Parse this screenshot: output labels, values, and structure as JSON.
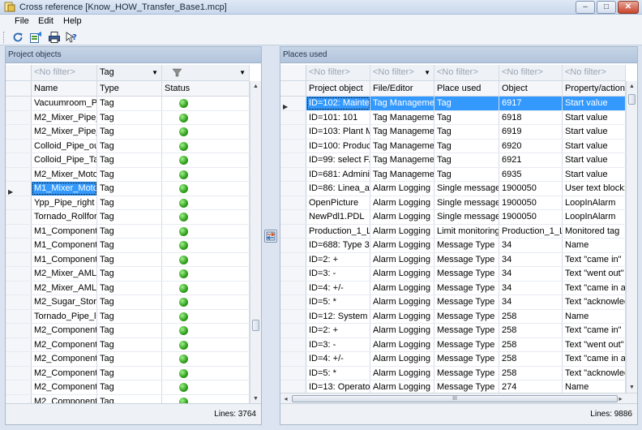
{
  "window": {
    "title": "Cross reference [Know_HOW_Transfer_Base1.mcp]",
    "icon": "cross-reference-app-icon"
  },
  "menu": [
    "File",
    "Edit",
    "Help"
  ],
  "toolbar": {
    "icons": [
      "refresh-icon",
      "export-icon",
      "print-icon",
      "help-icon"
    ]
  },
  "left_panel": {
    "title": "Project objects",
    "filters": [
      {
        "text": "<No filter>",
        "dropdown": false
      },
      {
        "text": "Tag",
        "dropdown": true
      },
      {
        "text": "",
        "dropdown": true,
        "icon": "filter-funnel-icon"
      }
    ],
    "columns": [
      "Name",
      "Type",
      "Status"
    ],
    "rows": [
      {
        "name": "Vacuumroom_Pi...",
        "type": "Tag"
      },
      {
        "name": "M2_Mixer_Pipe_...",
        "type": "Tag"
      },
      {
        "name": "M2_Mixer_Pipe_...",
        "type": "Tag"
      },
      {
        "name": "Colloid_Pipe_out...",
        "type": "Tag"
      },
      {
        "name": "Colloid_Pipe_Tank",
        "type": "Tag"
      },
      {
        "name": "M2_Mixer_Motor",
        "type": "Tag"
      },
      {
        "name": "M1_Mixer_Motor",
        "type": "Tag",
        "selected": true
      },
      {
        "name": "Ypp_Pipe_right",
        "type": "Tag"
      },
      {
        "name": "Tornado_Rollfor...",
        "type": "Tag"
      },
      {
        "name": "M1_Component...",
        "type": "Tag"
      },
      {
        "name": "M1_Component...",
        "type": "Tag"
      },
      {
        "name": "M1_Component...",
        "type": "Tag"
      },
      {
        "name": "M2_Mixer_AML_...",
        "type": "Tag"
      },
      {
        "name": "M2_Mixer_AML_...",
        "type": "Tag"
      },
      {
        "name": "M2_Sugar_Stora...",
        "type": "Tag"
      },
      {
        "name": "Tornado_Pipe_le...",
        "type": "Tag"
      },
      {
        "name": "M2_Component...",
        "type": "Tag"
      },
      {
        "name": "M2_Component...",
        "type": "Tag"
      },
      {
        "name": "M2_Component...",
        "type": "Tag"
      },
      {
        "name": "M2_Component...",
        "type": "Tag"
      },
      {
        "name": "M2_Component...",
        "type": "Tag"
      },
      {
        "name": "M2_Component...",
        "type": "Tag"
      }
    ],
    "lines_label": "Lines: 3764"
  },
  "right_panel": {
    "title": "Places used",
    "filters": [
      "<No filter>",
      "<No filter>",
      "<No filter>",
      "<No filter>",
      "<No filter>"
    ],
    "columns": [
      "Project object",
      "File/Editor",
      "Place used",
      "Object",
      "Property/action"
    ],
    "rows": [
      {
        "obj": "ID=102: Mainte...",
        "editor": "Tag Management",
        "place": "Tag",
        "object": "6917",
        "prop": "Start value",
        "selected": true
      },
      {
        "obj": "ID=101: 101",
        "editor": "Tag Management",
        "place": "Tag",
        "object": "6918",
        "prop": "Start value"
      },
      {
        "obj": "ID=103: Plant M...",
        "editor": "Tag Management",
        "place": "Tag",
        "object": "6919",
        "prop": "Start value"
      },
      {
        "obj": "ID=100: Produc...",
        "editor": "Tag Management",
        "place": "Tag",
        "object": "6920",
        "prop": "Start value"
      },
      {
        "obj": "ID=99: select F...",
        "editor": "Tag Management",
        "place": "Tag",
        "object": "6921",
        "prop": "Start value"
      },
      {
        "obj": "ID=681: Adminis...",
        "editor": "Tag Management",
        "place": "Tag",
        "object": "6935",
        "prop": "Start value"
      },
      {
        "obj": "ID=86: Linea_a...",
        "editor": "Alarm Logging",
        "place": "Single message",
        "object": "1900050",
        "prop": "User text block: 1"
      },
      {
        "obj": "OpenPicture",
        "editor": "Alarm Logging",
        "place": "Single message",
        "object": "1900050",
        "prop": "LoopInAlarm"
      },
      {
        "obj": "NewPdl1.PDL",
        "editor": "Alarm Logging",
        "place": "Single message",
        "object": "1900050",
        "prop": "LoopInAlarm"
      },
      {
        "obj": "Production_1_Li...",
        "editor": "Alarm Logging",
        "place": "Limit monitoring",
        "object": "Production_1_Li...",
        "prop": "Monitored tag"
      },
      {
        "obj": "ID=688: Type 34",
        "editor": "Alarm Logging",
        "place": "Message Type",
        "object": "34",
        "prop": "Name"
      },
      {
        "obj": "ID=2: +",
        "editor": "Alarm Logging",
        "place": "Message Type",
        "object": "34",
        "prop": "Text \"came in\""
      },
      {
        "obj": "ID=3: -",
        "editor": "Alarm Logging",
        "place": "Message Type",
        "object": "34",
        "prop": "Text \"went out\""
      },
      {
        "obj": "ID=4: +/-",
        "editor": "Alarm Logging",
        "place": "Message Type",
        "object": "34",
        "prop": "Text \"came in an..."
      },
      {
        "obj": "ID=5: *",
        "editor": "Alarm Logging",
        "place": "Message Type",
        "object": "34",
        "prop": "Text \"acknowled..."
      },
      {
        "obj": "ID=12: System ...",
        "editor": "Alarm Logging",
        "place": "Message Type",
        "object": "258",
        "prop": "Name"
      },
      {
        "obj": "ID=2: +",
        "editor": "Alarm Logging",
        "place": "Message Type",
        "object": "258",
        "prop": "Text \"came in\""
      },
      {
        "obj": "ID=3: -",
        "editor": "Alarm Logging",
        "place": "Message Type",
        "object": "258",
        "prop": "Text \"went out\""
      },
      {
        "obj": "ID=4: +/-",
        "editor": "Alarm Logging",
        "place": "Message Type",
        "object": "258",
        "prop": "Text \"came in an..."
      },
      {
        "obj": "ID=5: *",
        "editor": "Alarm Logging",
        "place": "Message Type",
        "object": "258",
        "prop": "Text \"acknowled..."
      },
      {
        "obj": "ID=13: Operato...",
        "editor": "Alarm Logging",
        "place": "Message Type",
        "object": "274",
        "prop": "Name"
      }
    ],
    "hscroll_grip": "III",
    "lines_label": "Lines: 9886"
  },
  "colors": {
    "selection": "#3399ff",
    "status_ok": "#2e9e1a"
  }
}
